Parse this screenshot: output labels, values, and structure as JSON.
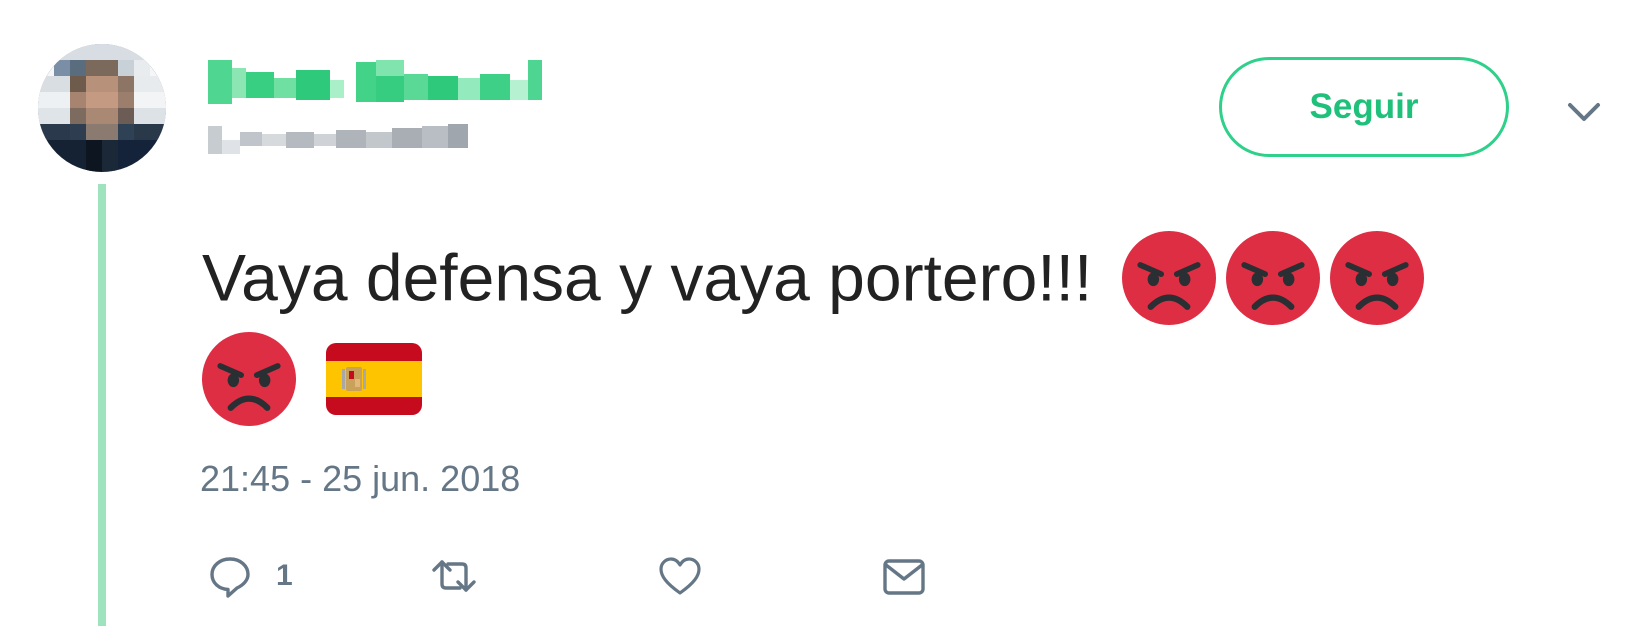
{
  "tweet": {
    "author_name": "",
    "author_handle": "",
    "follow_label": "Seguir",
    "text": "Vaya defensa y vaya portero!!!",
    "emojis_line1": [
      "angry-face",
      "angry-face",
      "angry-face"
    ],
    "emojis_line2": [
      "angry-face",
      "spain-flag"
    ],
    "timestamp": "21:45 - 25 jun. 2018",
    "reply_count": "1",
    "actions": [
      "reply-icon",
      "retweet-icon",
      "like-icon",
      "direct-message-icon"
    ]
  },
  "colors": {
    "accent": "#2fd08a",
    "thread_line": "#9ee3bd",
    "muted": "#657786",
    "angry_red": "#dd2e44"
  }
}
